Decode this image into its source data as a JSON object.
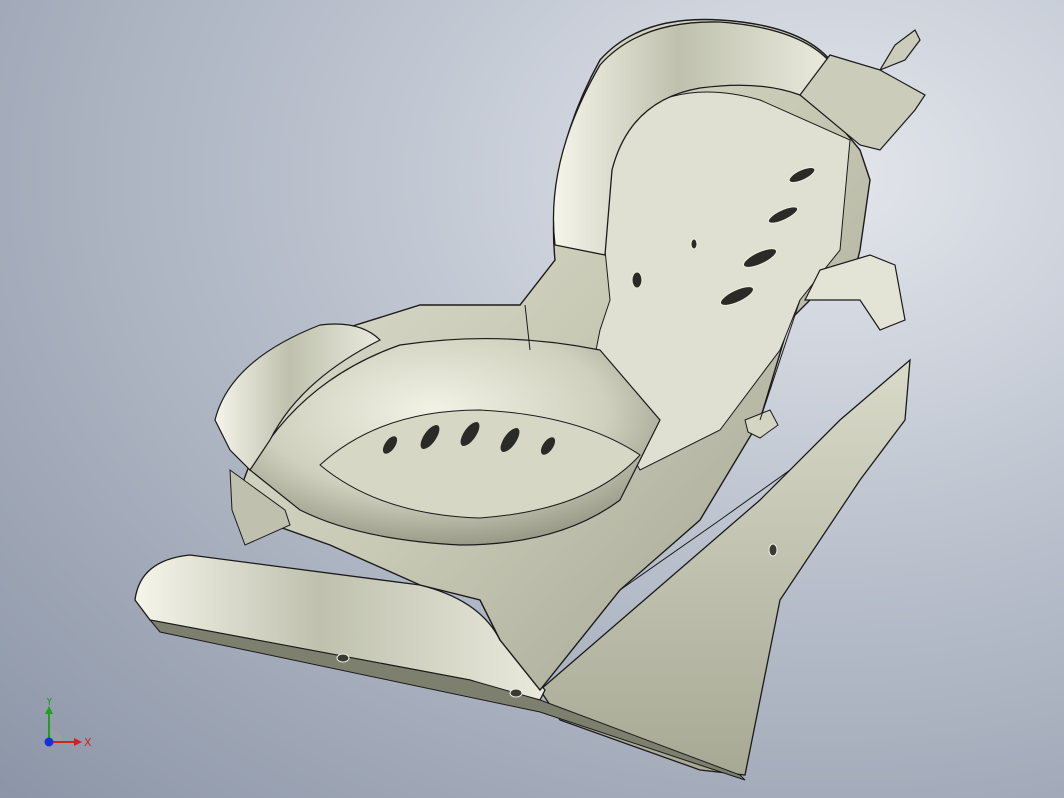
{
  "viewport": {
    "background_top": "#e3e6ec",
    "background_bottom": "#8c95a7",
    "model_color": "#c9cbb9",
    "edge_color": "#1a1a1a"
  },
  "triad": {
    "x_label": "X",
    "y_label": "Y",
    "x_color": "#d42020",
    "y_color": "#1ea01e",
    "origin_color": "#1b2fd8"
  }
}
